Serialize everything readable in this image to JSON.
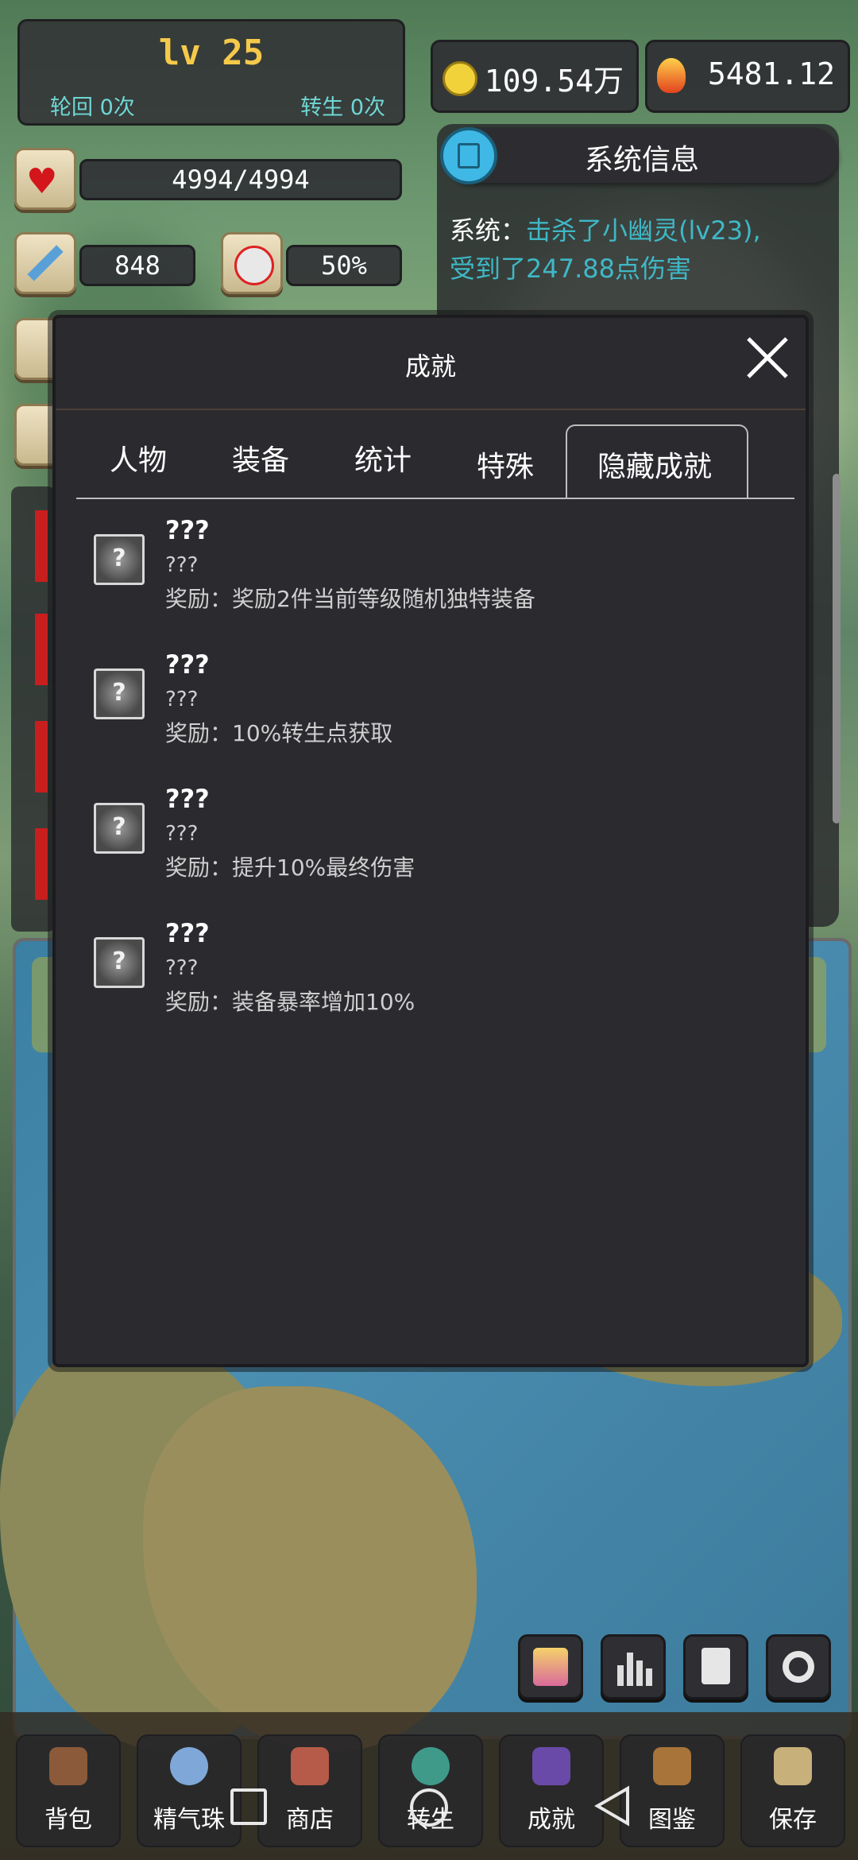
{
  "player": {
    "level": "lv 25",
    "reincarnation": "轮回 0次",
    "rebirth": "转生 0次",
    "hp": "4994/4994",
    "attack": "848",
    "crit_rate": "50%"
  },
  "currency": {
    "coins": "109.54万",
    "fire": "5481.12"
  },
  "system_info": {
    "title": "系统信息",
    "log_prefix": "系统：",
    "log_message_line1": "击杀了小幽灵(lv23),",
    "log_message_line2": "受到了247.88点伤害"
  },
  "dialog": {
    "title": "成就",
    "tabs": [
      "人物",
      "装备",
      "统计",
      "特殊",
      "隐藏成就"
    ],
    "active_tab": "隐藏成就",
    "achievements": [
      {
        "name": "???",
        "desc": "???",
        "reward": "奖励：奖励2件当前等级随机独特装备"
      },
      {
        "name": "???",
        "desc": "???",
        "reward": "奖励：10%转生点获取"
      },
      {
        "name": "???",
        "desc": "???",
        "reward": "奖励：提升10%最终伤害"
      },
      {
        "name": "???",
        "desc": "???",
        "reward": "奖励：装备暴率增加10%"
      }
    ],
    "icon_glyph": "?"
  },
  "bottom_nav": [
    {
      "label": "背包",
      "icon": "backpack-icon",
      "color": "#8a5a3a"
    },
    {
      "label": "精气珠",
      "icon": "orb-icon",
      "color": "#7fa8d8"
    },
    {
      "label": "商店",
      "icon": "shop-icon",
      "color": "#b65a4a"
    },
    {
      "label": "转生",
      "icon": "rebirth-icon",
      "color": "#3f9a8a"
    },
    {
      "label": "成就",
      "icon": "achievement-book-icon",
      "color": "#6a4aa8"
    },
    {
      "label": "图鉴",
      "icon": "codex-icon",
      "color": "#a8743a"
    },
    {
      "label": "保存",
      "icon": "save-icon",
      "color": "#c8b07a"
    }
  ],
  "colors": {
    "level": "#f5c94a",
    "cyan_text": "#6fd7d5",
    "dialog_bg": "#2b2a2f"
  }
}
